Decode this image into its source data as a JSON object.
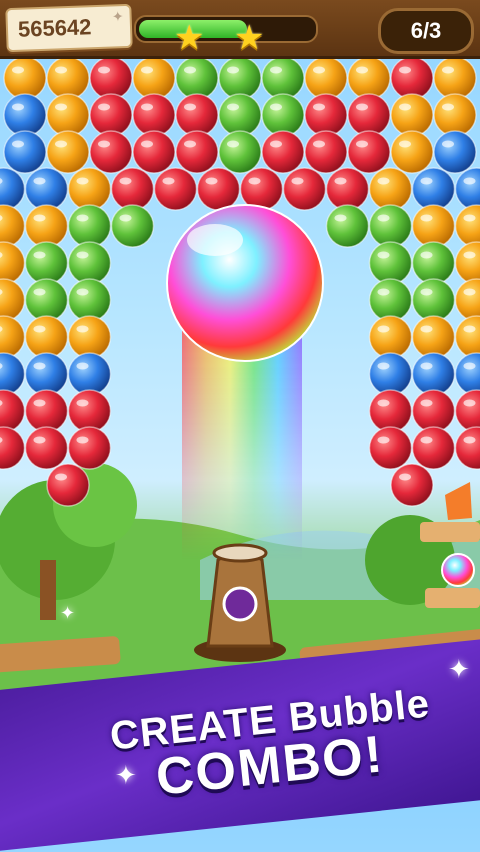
{
  "hud": {
    "score": "565642",
    "level_progress": 0.62,
    "stars_earned": 2,
    "moves": "6/3"
  },
  "banner": {
    "line1": "CREATE Bubble",
    "line2": "COMBO!"
  },
  "colors": {
    "strawberry": "#e5283a",
    "orange": "#f6a316",
    "blueberry": "#2f7fe6",
    "melon": "#5fc23a",
    "rainbow_beam": [
      "#ff4d4d",
      "#ffb13b",
      "#fff24a",
      "#5ee35a",
      "#43c7ff",
      "#8a5bff"
    ]
  },
  "bubble_grid": {
    "rows": [
      "OOSOMMMOOSO",
      "BOSSSMMSSOO",
      "BOSSSMSSSOB",
      "BBOSSSSSSOBB",
      "BOOMM    MMOOB",
      "BOMM      MMOB",
      "OOMM      MMOO",
      "OOOO      OOOO",
      "BBBB      BBBB",
      "SSSS      SSSS",
      "SSSS      SSSS",
      "   S       S   "
    ]
  },
  "shooter": {
    "loaded_fruit": "grape",
    "special_bubble": "rainbow"
  }
}
